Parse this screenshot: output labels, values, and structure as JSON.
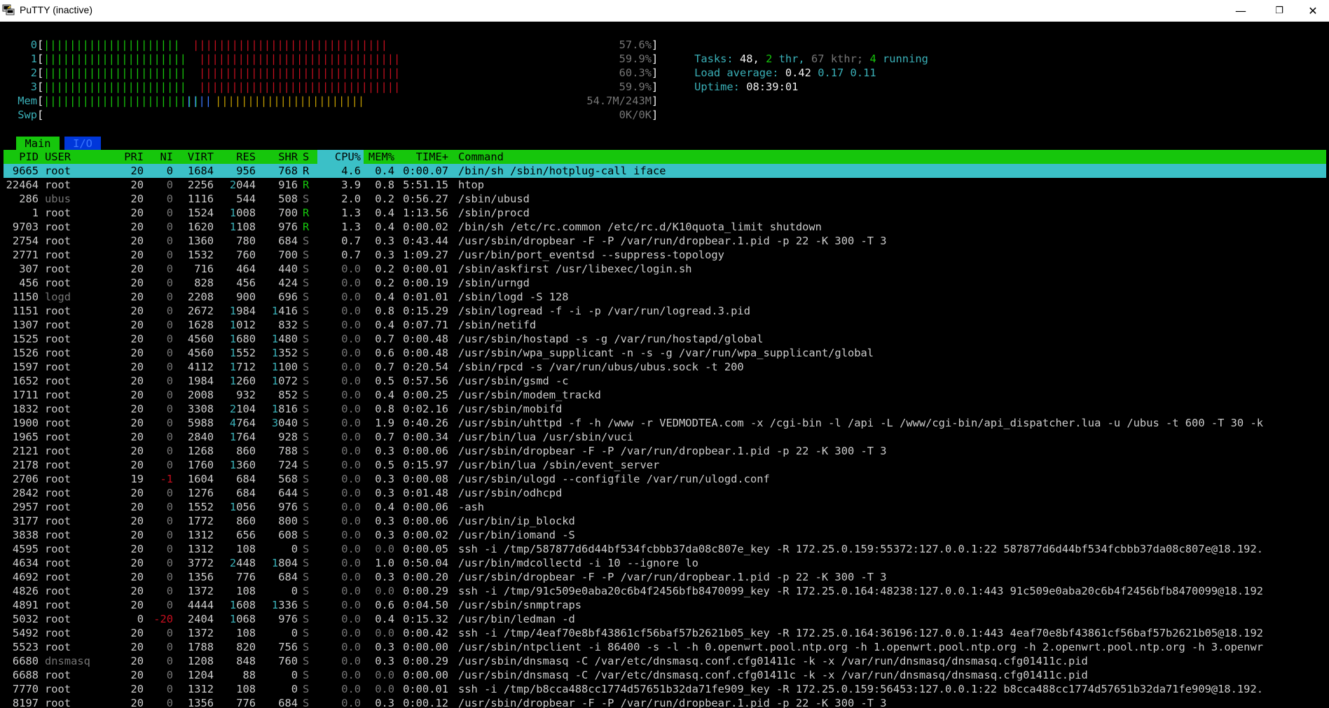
{
  "window": {
    "title": "PuTTY (inactive)",
    "minimize": "—",
    "restore": "❐",
    "close": "✕"
  },
  "meters": {
    "cpus": [
      {
        "label": "0",
        "green_bars": "|||||||||||||||||||||",
        "red_bars": "||||||||||||||||||||||||||||||",
        "value": "57.6%"
      },
      {
        "label": "1",
        "green_bars": "||||||||||||||||||||||",
        "red_bars": "|||||||||||||||||||||||||||||||",
        "value": "59.9%"
      },
      {
        "label": "2",
        "green_bars": "||||||||||||||||||||||",
        "red_bars": "|||||||||||||||||||||||||||||||",
        "value": "60.3%"
      },
      {
        "label": "3",
        "green_bars": "||||||||||||||||||||||",
        "red_bars": "|||||||||||||||||||||||||||||||",
        "value": "59.9%"
      }
    ],
    "mem": {
      "label": "Mem",
      "green_bars": "||||||||||||||||||||||||",
      "blue_bars": "||||",
      "yellow_bars": "|||||||||||||||||||||||",
      "value": "54.7M/243M"
    },
    "swp": {
      "label": "Swp",
      "value": "0K/0K"
    }
  },
  "summary": {
    "tasks_label": "Tasks:",
    "tasks": "48,",
    "thr": "2",
    "thr_label": "thr,",
    "kthr": "67",
    "kthr_label": "kthr;",
    "running": "4",
    "running_label": "running",
    "load_label": "Load average:",
    "load1": "0.42",
    "load5": "0.17",
    "load15": "0.11",
    "uptime_label": "Uptime:",
    "uptime": "08:39:01"
  },
  "tabs": {
    "main": "Main",
    "io": "I/O"
  },
  "columns": {
    "pid": "PID",
    "user": "USER",
    "pri": "PRI",
    "ni": "NI",
    "virt": "VIRT",
    "res": "RES",
    "shr": "SHR",
    "s": "S",
    "cpu": "CPU%",
    "mem": "MEM%",
    "time": "TIME+",
    "command": "Command"
  },
  "processes": [
    {
      "pid": "9665",
      "user": "root",
      "pri": "20",
      "ni": "0",
      "virt": "1684",
      "res": "956",
      "shr": "768",
      "s": "R",
      "cpu": "4.6",
      "mem": "0.4",
      "time": "0:00.07",
      "cmd": "/bin/sh /sbin/hotplug-call iface"
    },
    {
      "pid": "22464",
      "user": "root",
      "pri": "20",
      "ni": "0",
      "virt": "2256",
      "res": "2044",
      "shr": "916",
      "s": "R",
      "cpu": "3.9",
      "mem": "0.8",
      "time": "5:51.15",
      "cmd": "htop"
    },
    {
      "pid": "286",
      "user": "ubus",
      "pri": "20",
      "ni": "0",
      "virt": "1116",
      "res": "544",
      "shr": "508",
      "s": "S",
      "cpu": "2.0",
      "mem": "0.2",
      "time": "0:56.27",
      "cmd": "/sbin/ubusd"
    },
    {
      "pid": "1",
      "user": "root",
      "pri": "20",
      "ni": "0",
      "virt": "1524",
      "res": "1008",
      "shr": "700",
      "s": "R",
      "cpu": "1.3",
      "mem": "0.4",
      "time": "1:13.56",
      "cmd": "/sbin/procd"
    },
    {
      "pid": "9703",
      "user": "root",
      "pri": "20",
      "ni": "0",
      "virt": "1620",
      "res": "1108",
      "shr": "976",
      "s": "R",
      "cpu": "1.3",
      "mem": "0.4",
      "time": "0:00.02",
      "cmd": "/bin/sh /etc/rc.common /etc/rc.d/K10quota_limit shutdown"
    },
    {
      "pid": "2754",
      "user": "root",
      "pri": "20",
      "ni": "0",
      "virt": "1360",
      "res": "780",
      "shr": "684",
      "s": "S",
      "cpu": "0.7",
      "mem": "0.3",
      "time": "0:43.44",
      "cmd": "/usr/sbin/dropbear -F -P /var/run/dropbear.1.pid -p 22 -K 300 -T 3"
    },
    {
      "pid": "2771",
      "user": "root",
      "pri": "20",
      "ni": "0",
      "virt": "1532",
      "res": "760",
      "shr": "700",
      "s": "S",
      "cpu": "0.7",
      "mem": "0.3",
      "time": "1:09.27",
      "cmd": "/usr/bin/port_eventsd --suppress-topology"
    },
    {
      "pid": "307",
      "user": "root",
      "pri": "20",
      "ni": "0",
      "virt": "716",
      "res": "464",
      "shr": "440",
      "s": "S",
      "cpu": "0.0",
      "mem": "0.2",
      "time": "0:00.01",
      "cmd": "/sbin/askfirst /usr/libexec/login.sh"
    },
    {
      "pid": "456",
      "user": "root",
      "pri": "20",
      "ni": "0",
      "virt": "828",
      "res": "456",
      "shr": "424",
      "s": "S",
      "cpu": "0.0",
      "mem": "0.2",
      "time": "0:00.19",
      "cmd": "/sbin/urngd"
    },
    {
      "pid": "1150",
      "user": "logd",
      "pri": "20",
      "ni": "0",
      "virt": "2208",
      "res": "900",
      "shr": "696",
      "s": "S",
      "cpu": "0.0",
      "mem": "0.4",
      "time": "0:01.01",
      "cmd": "/sbin/logd -S 128"
    },
    {
      "pid": "1151",
      "user": "root",
      "pri": "20",
      "ni": "0",
      "virt": "2672",
      "res": "1984",
      "shr": "1416",
      "s": "S",
      "cpu": "0.0",
      "mem": "0.8",
      "time": "0:15.29",
      "cmd": "/sbin/logread -f -i -p /var/run/logread.3.pid"
    },
    {
      "pid": "1307",
      "user": "root",
      "pri": "20",
      "ni": "0",
      "virt": "1628",
      "res": "1012",
      "shr": "832",
      "s": "S",
      "cpu": "0.0",
      "mem": "0.4",
      "time": "0:07.71",
      "cmd": "/sbin/netifd"
    },
    {
      "pid": "1525",
      "user": "root",
      "pri": "20",
      "ni": "0",
      "virt": "4560",
      "res": "1680",
      "shr": "1480",
      "s": "S",
      "cpu": "0.0",
      "mem": "0.7",
      "time": "0:00.48",
      "cmd": "/usr/sbin/hostapd -s -g /var/run/hostapd/global"
    },
    {
      "pid": "1526",
      "user": "root",
      "pri": "20",
      "ni": "0",
      "virt": "4560",
      "res": "1552",
      "shr": "1352",
      "s": "S",
      "cpu": "0.0",
      "mem": "0.6",
      "time": "0:00.48",
      "cmd": "/usr/sbin/wpa_supplicant -n -s -g /var/run/wpa_supplicant/global"
    },
    {
      "pid": "1597",
      "user": "root",
      "pri": "20",
      "ni": "0",
      "virt": "4112",
      "res": "1712",
      "shr": "1100",
      "s": "S",
      "cpu": "0.0",
      "mem": "0.7",
      "time": "0:20.54",
      "cmd": "/sbin/rpcd -s /var/run/ubus/ubus.sock -t 200"
    },
    {
      "pid": "1652",
      "user": "root",
      "pri": "20",
      "ni": "0",
      "virt": "1984",
      "res": "1260",
      "shr": "1072",
      "s": "S",
      "cpu": "0.0",
      "mem": "0.5",
      "time": "0:57.56",
      "cmd": "/usr/sbin/gsmd -c"
    },
    {
      "pid": "1711",
      "user": "root",
      "pri": "20",
      "ni": "0",
      "virt": "2008",
      "res": "932",
      "shr": "852",
      "s": "S",
      "cpu": "0.0",
      "mem": "0.4",
      "time": "0:00.25",
      "cmd": "/usr/sbin/modem_trackd"
    },
    {
      "pid": "1832",
      "user": "root",
      "pri": "20",
      "ni": "0",
      "virt": "3308",
      "res": "2104",
      "shr": "1816",
      "s": "S",
      "cpu": "0.0",
      "mem": "0.8",
      "time": "0:02.16",
      "cmd": "/usr/sbin/mobifd"
    },
    {
      "pid": "1900",
      "user": "root",
      "pri": "20",
      "ni": "0",
      "virt": "5988",
      "res": "4764",
      "shr": "3040",
      "s": "S",
      "cpu": "0.0",
      "mem": "1.9",
      "time": "0:40.26",
      "cmd": "/usr/sbin/uhttpd -f -h /www -r VEDMODTEA.com -x /cgi-bin -l /api -L /www/cgi-bin/api_dispatcher.lua -u /ubus -t 600 -T 30 -k"
    },
    {
      "pid": "1965",
      "user": "root",
      "pri": "20",
      "ni": "0",
      "virt": "2840",
      "res": "1764",
      "shr": "928",
      "s": "S",
      "cpu": "0.0",
      "mem": "0.7",
      "time": "0:00.34",
      "cmd": "/usr/bin/lua /usr/sbin/vuci"
    },
    {
      "pid": "2121",
      "user": "root",
      "pri": "20",
      "ni": "0",
      "virt": "1268",
      "res": "860",
      "shr": "788",
      "s": "S",
      "cpu": "0.0",
      "mem": "0.3",
      "time": "0:00.06",
      "cmd": "/usr/sbin/dropbear -F -P /var/run/dropbear.1.pid -p 22 -K 300 -T 3"
    },
    {
      "pid": "2178",
      "user": "root",
      "pri": "20",
      "ni": "0",
      "virt": "1760",
      "res": "1360",
      "shr": "724",
      "s": "S",
      "cpu": "0.0",
      "mem": "0.5",
      "time": "0:15.97",
      "cmd": "/usr/bin/lua /sbin/event_server"
    },
    {
      "pid": "2706",
      "user": "root",
      "pri": "19",
      "ni": "-1",
      "virt": "1604",
      "res": "684",
      "shr": "568",
      "s": "S",
      "cpu": "0.0",
      "mem": "0.3",
      "time": "0:00.08",
      "cmd": "/usr/sbin/ulogd --configfile /var/run/ulogd.conf"
    },
    {
      "pid": "2842",
      "user": "root",
      "pri": "20",
      "ni": "0",
      "virt": "1276",
      "res": "684",
      "shr": "644",
      "s": "S",
      "cpu": "0.0",
      "mem": "0.3",
      "time": "0:01.48",
      "cmd": "/usr/sbin/odhcpd"
    },
    {
      "pid": "2957",
      "user": "root",
      "pri": "20",
      "ni": "0",
      "virt": "1552",
      "res": "1056",
      "shr": "976",
      "s": "S",
      "cpu": "0.0",
      "mem": "0.4",
      "time": "0:00.06",
      "cmd": "-ash"
    },
    {
      "pid": "3177",
      "user": "root",
      "pri": "20",
      "ni": "0",
      "virt": "1772",
      "res": "860",
      "shr": "800",
      "s": "S",
      "cpu": "0.0",
      "mem": "0.3",
      "time": "0:00.06",
      "cmd": "/usr/bin/ip_blockd"
    },
    {
      "pid": "3838",
      "user": "root",
      "pri": "20",
      "ni": "0",
      "virt": "1312",
      "res": "656",
      "shr": "608",
      "s": "S",
      "cpu": "0.0",
      "mem": "0.3",
      "time": "0:00.02",
      "cmd": "/usr/bin/iomand -S"
    },
    {
      "pid": "4595",
      "user": "root",
      "pri": "20",
      "ni": "0",
      "virt": "1312",
      "res": "108",
      "shr": "0",
      "s": "S",
      "cpu": "0.0",
      "mem": "0.0",
      "time": "0:00.05",
      "cmd": "ssh -i /tmp/587877d6d44bf534fcbbb37da08c807e_key -R 172.25.0.159:55372:127.0.0.1:22 587877d6d44bf534fcbbb37da08c807e@18.192."
    },
    {
      "pid": "4634",
      "user": "root",
      "pri": "20",
      "ni": "0",
      "virt": "3772",
      "res": "2448",
      "shr": "1804",
      "s": "S",
      "cpu": "0.0",
      "mem": "1.0",
      "time": "0:50.04",
      "cmd": "/usr/bin/mdcollectd -i 10 --ignore lo"
    },
    {
      "pid": "4692",
      "user": "root",
      "pri": "20",
      "ni": "0",
      "virt": "1356",
      "res": "776",
      "shr": "684",
      "s": "S",
      "cpu": "0.0",
      "mem": "0.3",
      "time": "0:00.20",
      "cmd": "/usr/sbin/dropbear -F -P /var/run/dropbear.1.pid -p 22 -K 300 -T 3"
    },
    {
      "pid": "4826",
      "user": "root",
      "pri": "20",
      "ni": "0",
      "virt": "1372",
      "res": "108",
      "shr": "0",
      "s": "S",
      "cpu": "0.0",
      "mem": "0.0",
      "time": "0:00.29",
      "cmd": "ssh -i /tmp/91c509e0aba20c6b4f2456bfb8470099_key -R 172.25.0.164:48238:127.0.0.1:443 91c509e0aba20c6b4f2456bfb8470099@18.192"
    },
    {
      "pid": "4891",
      "user": "root",
      "pri": "20",
      "ni": "0",
      "virt": "4444",
      "res": "1608",
      "shr": "1336",
      "s": "S",
      "cpu": "0.0",
      "mem": "0.6",
      "time": "0:04.50",
      "cmd": "/usr/sbin/snmptraps"
    },
    {
      "pid": "5032",
      "user": "root",
      "pri": "0",
      "ni": "-20",
      "virt": "2404",
      "res": "1068",
      "shr": "976",
      "s": "S",
      "cpu": "0.0",
      "mem": "0.4",
      "time": "0:15.32",
      "cmd": "/usr/bin/ledman -d"
    },
    {
      "pid": "5492",
      "user": "root",
      "pri": "20",
      "ni": "0",
      "virt": "1372",
      "res": "108",
      "shr": "0",
      "s": "S",
      "cpu": "0.0",
      "mem": "0.0",
      "time": "0:00.42",
      "cmd": "ssh -i /tmp/4eaf70e8bf43861cf56baf57b2621b05_key -R 172.25.0.164:36196:127.0.0.1:443 4eaf70e8bf43861cf56baf57b2621b05@18.192"
    },
    {
      "pid": "5523",
      "user": "root",
      "pri": "20",
      "ni": "0",
      "virt": "1788",
      "res": "820",
      "shr": "756",
      "s": "S",
      "cpu": "0.0",
      "mem": "0.3",
      "time": "0:00.00",
      "cmd": "/usr/sbin/ntpclient -i 86400 -s -l -h 0.openwrt.pool.ntp.org -h 1.openwrt.pool.ntp.org -h 2.openwrt.pool.ntp.org -h 3.openwr"
    },
    {
      "pid": "6680",
      "user": "dnsmasq",
      "pri": "20",
      "ni": "0",
      "virt": "1208",
      "res": "848",
      "shr": "760",
      "s": "S",
      "cpu": "0.0",
      "mem": "0.3",
      "time": "0:00.29",
      "cmd": "/usr/sbin/dnsmasq -C /var/etc/dnsmasq.conf.cfg01411c -k -x /var/run/dnsmasq/dnsmasq.cfg01411c.pid"
    },
    {
      "pid": "6688",
      "user": "root",
      "pri": "20",
      "ni": "0",
      "virt": "1204",
      "res": "88",
      "shr": "0",
      "s": "S",
      "cpu": "0.0",
      "mem": "0.0",
      "time": "0:00.00",
      "cmd": "/usr/sbin/dnsmasq -C /var/etc/dnsmasq.conf.cfg01411c -k -x /var/run/dnsmasq/dnsmasq.cfg01411c.pid"
    },
    {
      "pid": "7770",
      "user": "root",
      "pri": "20",
      "ni": "0",
      "virt": "1312",
      "res": "108",
      "shr": "0",
      "s": "S",
      "cpu": "0.0",
      "mem": "0.0",
      "time": "0:00.01",
      "cmd": "ssh -i /tmp/b8cca488cc1774d57651b32da71fe909_key -R 172.25.0.159:56453:127.0.0.1:22 b8cca488cc1774d57651b32da71fe909@18.192."
    },
    {
      "pid": "8197",
      "user": "root",
      "pri": "20",
      "ni": "0",
      "virt": "1356",
      "res": "776",
      "shr": "684",
      "s": "S",
      "cpu": "0.0",
      "mem": "0.3",
      "time": "0:00.12",
      "cmd": "/usr/sbin/dropbear -F -P /var/run/dropbear.1.pid -p 22 -K 300 -T 3"
    }
  ]
}
